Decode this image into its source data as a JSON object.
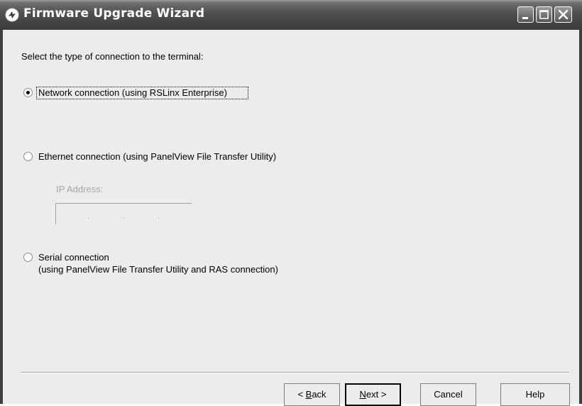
{
  "window": {
    "title": "Firmware Upgrade Wizard"
  },
  "prompt": "Select the type of connection to the terminal:",
  "options": [
    {
      "label": "Network connection (using RSLinx Enterprise)",
      "selected": true
    },
    {
      "label": "Ethernet connection (using PanelView File Transfer Utility)",
      "selected": false
    },
    {
      "label_line1": "Serial connection",
      "label_line2": "(using PanelView File Transfer Utility and RAS connection)",
      "selected": false
    }
  ],
  "ip": {
    "label": "IP Address:",
    "value": ""
  },
  "buttons": {
    "back_prefix": "< ",
    "back_mnemonic": "B",
    "back_rest": "ack",
    "next_mnemonic": "N",
    "next_rest": "ext >",
    "cancel": "Cancel",
    "help": "Help"
  },
  "colors": {
    "titlebar": "#4f4f4f",
    "background": "#ececec"
  },
  "icons": [
    "firmware-icon",
    "minimize-icon",
    "maximize-icon",
    "close-icon"
  ]
}
